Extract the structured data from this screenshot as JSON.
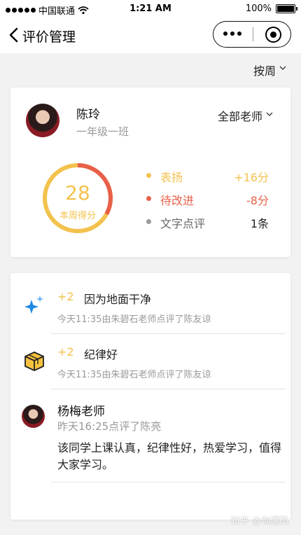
{
  "status_bar": {
    "carrier": "中国联通",
    "time": "1:21 AM",
    "battery": "100%"
  },
  "nav": {
    "title": "评价管理"
  },
  "period_filter": "按周",
  "teacher": {
    "name": "陈玲",
    "class": "一年级一班",
    "filter": "全部老师"
  },
  "summary": {
    "score": "28",
    "score_label": "本周得分",
    "ring_red_fraction": 0.33,
    "legend": [
      {
        "label": "表扬",
        "value": "+16分",
        "color": "#f3c24d"
      },
      {
        "label": "待改进",
        "value": "-8分",
        "color": "#e8604a"
      },
      {
        "label": "文字点评",
        "value": "1条",
        "color": "#999999"
      }
    ]
  },
  "records": [
    {
      "points": "+2",
      "reason": "因为地面干净",
      "meta": "今天11:35由朱碧石老师点评了陈友谅",
      "icon": "sparkle-icon"
    },
    {
      "points": "+2",
      "reason": "纪律好",
      "meta": "今天11:35由朱碧石老师点评了陈友谅",
      "icon": "cube-icon"
    }
  ],
  "comment": {
    "teacher": "杨梅老师",
    "meta": "昨天16:25点评了陈亮",
    "text": "该同学上课认真，纪律性好，热爱学习，值得大家学习。"
  },
  "watermark": "知乎 @询源码"
}
